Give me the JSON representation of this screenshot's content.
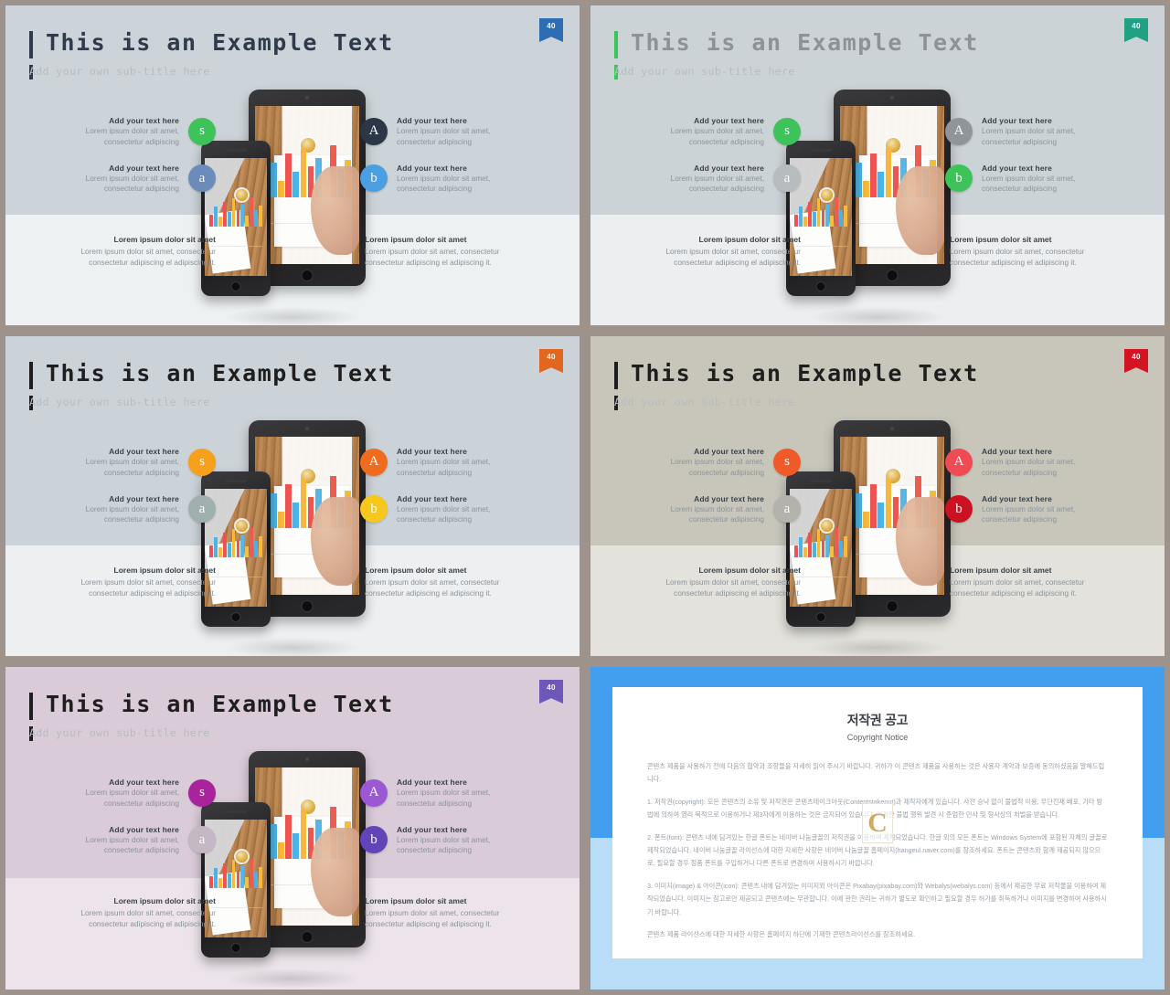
{
  "deck": {
    "gutter_color": "#9d938c",
    "slides": [
      {
        "id": "slide-1",
        "badge": "40",
        "badge_color": "#2e6db4",
        "accent_color": "#2f3b4a",
        "title": "This is an Example Text",
        "title_color": "#2f3b4a",
        "subtitle": "Add your own sub-title here",
        "bg_top": "#ccd4d9",
        "bg_bottom": "#eef1f2",
        "bullets_left": [
          {
            "letter": "s",
            "circle_color": "#3ec35a",
            "heading": "Add your text here",
            "body": "Lorem ipsum dolor sit amet, consectetur adipiscing"
          },
          {
            "letter": "a",
            "circle_color": "#6b8cba",
            "heading": "Add your text here",
            "body": "Lorem ipsum dolor sit amet, consectetur adipiscing"
          }
        ],
        "bullets_right": [
          {
            "letter": "A",
            "circle_color": "#2b3647",
            "heading": "Add your text here",
            "body": "Lorem ipsum dolor sit amet, consectetur adipiscing"
          },
          {
            "letter": "b",
            "circle_color": "#4b9fe0",
            "heading": "Add your text here",
            "body": "Lorem ipsum dolor sit amet, consectetur adipiscing"
          }
        ],
        "footer_left": {
          "heading": "Lorem ipsum dolor sit amet",
          "body": "Lorem ipsum dolor sit amet, consectetur consectetur adipiscing el adipiscing it."
        },
        "footer_right": {
          "heading": "Lorem ipsum dolor sit amet",
          "body": "Lorem ipsum dolor sit amet, consectetur consectetur adipiscing el adipiscing it."
        }
      },
      {
        "id": "slide-2",
        "badge": "40",
        "badge_color": "#1fa183",
        "accent_color": "#3ec35a",
        "title": "This is an Example Text",
        "title_color": "#8d9296",
        "subtitle": "Add your own sub-title here",
        "bg_top": "#ccd3d7",
        "bg_bottom": "#eceeef",
        "bullets_left": [
          {
            "letter": "s",
            "circle_color": "#3ec35a",
            "heading": "Add your text here",
            "body": "Lorem ipsum dolor sit amet, consectetur adipiscing"
          },
          {
            "letter": "a",
            "circle_color": "#b7bcbf",
            "heading": "Add your text here",
            "body": "Lorem ipsum dolor sit amet, consectetur adipiscing"
          }
        ],
        "bullets_right": [
          {
            "letter": "A",
            "circle_color": "#8f9599",
            "heading": "Add your text here",
            "body": "Lorem ipsum dolor sit amet, consectetur adipiscing"
          },
          {
            "letter": "b",
            "circle_color": "#3ec35a",
            "heading": "Add your text here",
            "body": "Lorem ipsum dolor sit amet, consectetur adipiscing"
          }
        ],
        "footer_left": {
          "heading": "Lorem ipsum dolor sit amet",
          "body": "Lorem ipsum dolor sit amet, consectetur consectetur adipiscing el adipiscing it."
        },
        "footer_right": {
          "heading": "Lorem ipsum dolor sit amet",
          "body": "Lorem ipsum dolor sit amet, consectetur consectetur adipiscing el adipiscing it."
        }
      },
      {
        "id": "slide-3",
        "badge": "40",
        "badge_color": "#e3661e",
        "accent_color": "#1e1e1e",
        "title": "This is an Example Text",
        "title_color": "#1e1e1e",
        "subtitle": "Add your own sub-title here",
        "bg_top": "#ccd3d8",
        "bg_bottom": "#edeff0",
        "bullets_left": [
          {
            "letter": "s",
            "circle_color": "#f6a01b",
            "heading": "Add your text here",
            "body": "Lorem ipsum dolor sit amet, consectetur adipiscing"
          },
          {
            "letter": "a",
            "circle_color": "#9fb0ae",
            "heading": "Add your text here",
            "body": "Lorem ipsum dolor sit amet, consectetur adipiscing"
          }
        ],
        "bullets_right": [
          {
            "letter": "A",
            "circle_color": "#ef6c1f",
            "heading": "Add your text here",
            "body": "Lorem ipsum dolor sit amet, consectetur adipiscing"
          },
          {
            "letter": "b",
            "circle_color": "#f6c81b",
            "heading": "Add your text here",
            "body": "Lorem ipsum dolor sit amet, consectetur adipiscing"
          }
        ],
        "footer_left": {
          "heading": "Lorem ipsum dolor sit amet",
          "body": "Lorem ipsum dolor sit amet, consectetur consectetur adipiscing el adipiscing it."
        },
        "footer_right": {
          "heading": "Lorem ipsum dolor sit amet",
          "body": "Lorem ipsum dolor sit amet, consectetur consectetur adipiscing el adipiscing it."
        }
      },
      {
        "id": "slide-4",
        "badge": "40",
        "badge_color": "#d41423",
        "accent_color": "#1e1e1e",
        "title": "This is an Example Text",
        "title_color": "#1e1e1e",
        "subtitle": "Add your own sub-title here",
        "bg_top": "#c8c6bb",
        "bg_bottom": "#e3e2dc",
        "bullets_left": [
          {
            "letter": "s",
            "circle_color": "#f05a28",
            "heading": "Add your text here",
            "body": "Lorem ipsum dolor sit amet, consectetur adipiscing"
          },
          {
            "letter": "a",
            "circle_color": "#b3b3ab",
            "heading": "Add your text here",
            "body": "Lorem ipsum dolor sit amet, consectetur adipiscing"
          }
        ],
        "bullets_right": [
          {
            "letter": "A",
            "circle_color": "#f04a52",
            "heading": "Add your text here",
            "body": "Lorem ipsum dolor sit amet, consectetur adipiscing"
          },
          {
            "letter": "b",
            "circle_color": "#cc1122",
            "heading": "Add your text here",
            "body": "Lorem ipsum dolor sit amet, consectetur adipiscing"
          }
        ],
        "footer_left": {
          "heading": "Lorem ipsum dolor sit amet",
          "body": "Lorem ipsum dolor sit amet, consectetur consectetur adipiscing el adipiscing it."
        },
        "footer_right": {
          "heading": "Lorem ipsum dolor sit amet",
          "body": "Lorem ipsum dolor sit amet, consectetur consectetur adipiscing el adipiscing it."
        }
      },
      {
        "id": "slide-5",
        "badge": "40",
        "badge_color": "#6e57b8",
        "accent_color": "#1e1e1e",
        "title": "This is an Example Text",
        "title_color": "#1e1e1e",
        "subtitle": "Add your own sub-title here",
        "bg_top": "#d9cbd8",
        "bg_bottom": "#ece4ea",
        "bullets_left": [
          {
            "letter": "s",
            "circle_color": "#a9239c",
            "heading": "Add your text here",
            "body": "Lorem ipsum dolor sit amet, consectetur adipiscing"
          },
          {
            "letter": "a",
            "circle_color": "#c3b8c4",
            "heading": "Add your text here",
            "body": "Lorem ipsum dolor sit amet, consectetur adipiscing"
          }
        ],
        "bullets_right": [
          {
            "letter": "A",
            "circle_color": "#9a58d4",
            "heading": "Add your text here",
            "body": "Lorem ipsum dolor sit amet, consectetur adipiscing"
          },
          {
            "letter": "b",
            "circle_color": "#6145b8",
            "heading": "Add your text here",
            "body": "Lorem ipsum dolor sit amet, consectetur adipiscing"
          }
        ],
        "footer_left": {
          "heading": "Lorem ipsum dolor sit amet",
          "body": "Lorem ipsum dolor sit amet, consectetur consectetur adipiscing el adipiscing it."
        },
        "footer_right": {
          "heading": "Lorem ipsum dolor sit amet",
          "body": "Lorem ipsum dolor sit amet, consectetur consectetur adipiscing el adipiscing it."
        }
      }
    ]
  },
  "copyright": {
    "frame_color_top": "#429ff0",
    "frame_color_bottom": "#b9ddf6",
    "title": "저작권 공고",
    "subtitle": "Copyright Notice",
    "watermark": "C",
    "paragraphs": [
      "콘텐츠 제품을 사용하기 전에 다음의 협약과 조항들을 자세히 읽어 주시기 바랍니다. 귀하가 이 콘텐츠 제품을 사용하는 것은 사용자 계약과 보증에 동의하셨음을 말해드립니다.",
      "1. 저작권(copyright): 모든 콘텐츠의 소유 및 저작권은 콘텐츠테이크아웃(Contentstakeout)과 제작자에게 있습니다. 사전 승낙 없이 불법적 이용, 무단전재 배포, 기타 방법에 의하여 영리 목적으로 이용하거나 제3자에게 이용하는 것은 금지되어 있습니다. 이러한 불법 행위 발견 시 준엄한 민사 및 형사상의 처벌을 받습니다.",
      "2. 폰트(font): 콘텐츠 내에 담겨있는 한글 폰트는 네이버 나눔글꼴의 저작권을 이용하여 제작되었습니다. 한글 외의 모든 폰트는 Windows System에 포함된 자체의 글꼴로 제작되었습니다. 네이버 나눔글꼴 라이선스에 대한 자세한 사항은 네이버 나눔글꼴 홈페이지(hangeul.naver.com)를 참조하세요. 폰트는 콘텐츠와 함께 제공되지 않으므로, 필요할 경우 정품 폰트를 구입하거나 다른 폰트로 변경하여 사용하시기 바랍니다.",
      "3. 이미지(image) & 아이콘(icon): 콘텐츠 내에 담겨있는 이미지와 아이콘은 Pixabay(pixabay.com)와 Webalys(webalys.com) 등에서 제공한 무료 저작물을 이용하여 제작되었습니다. 이미지는 참고로만 제공되고 콘텐츠에는 무관합니다. 이에 관한 권리는 귀하가 별도로 확인하고 필요할 경우 허가를 취득하거나 이미지를 변경하여 사용하시기 바랍니다.",
      "콘텐츠 제품 라이선스에 대한 자세한 사항은 홈페이지 하단에 기재한 콘텐츠라이선스를 참조하세요."
    ]
  }
}
